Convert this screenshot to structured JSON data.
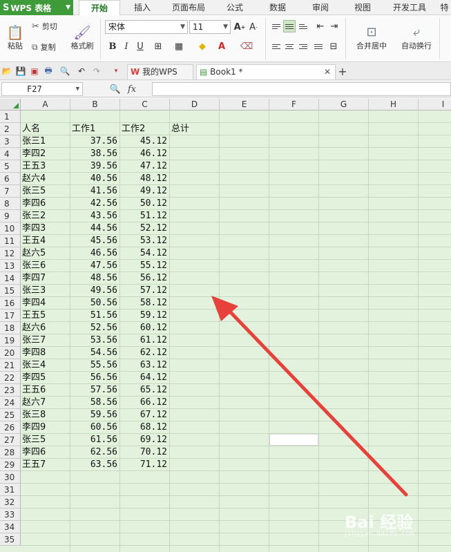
{
  "app": {
    "logo": "S",
    "name": "WPS 表格"
  },
  "menu": {
    "tabs": [
      "开始",
      "插入",
      "页面布局",
      "公式",
      "数据",
      "审阅",
      "视图",
      "开发工具",
      "特"
    ]
  },
  "ribbon": {
    "paste": "粘贴",
    "cut": "剪切",
    "copy": "复制",
    "format_painter": "格式刷",
    "font_name": "宋体",
    "font_size": "11",
    "bold": "B",
    "italic": "I",
    "underline": "U",
    "merge_center": "合并居中",
    "wrap_text": "自动换行"
  },
  "doc_tabs": {
    "home": "我的WPS",
    "book": "Book1 *"
  },
  "formula_bar": {
    "cell_ref": "F27",
    "fx": "fx",
    "value": ""
  },
  "sheet": {
    "columns": [
      "A",
      "B",
      "C",
      "D",
      "E",
      "F",
      "G",
      "H",
      "I"
    ],
    "row_numbers": [
      "1",
      "2",
      "3",
      "4",
      "5",
      "6",
      "7",
      "8",
      "9",
      "10",
      "11",
      "12",
      "13",
      "14",
      "15",
      "16",
      "17",
      "18",
      "19",
      "20",
      "21",
      "22",
      "23",
      "24",
      "25",
      "26",
      "27",
      "28",
      "29",
      "30",
      "31",
      "32",
      "33",
      "34",
      "35"
    ],
    "header": [
      "人名",
      "工作1",
      "工作2",
      "总计"
    ],
    "rows": [
      [
        "张三1",
        "37.56",
        "45.12"
      ],
      [
        "李四2",
        "38.56",
        "46.12"
      ],
      [
        "王五3",
        "39.56",
        "47.12"
      ],
      [
        "赵六4",
        "40.56",
        "48.12"
      ],
      [
        "张三5",
        "41.56",
        "49.12"
      ],
      [
        "李四6",
        "42.56",
        "50.12"
      ],
      [
        "张三2",
        "43.56",
        "51.12"
      ],
      [
        "李四3",
        "44.56",
        "52.12"
      ],
      [
        "王五4",
        "45.56",
        "53.12"
      ],
      [
        "赵六5",
        "46.56",
        "54.12"
      ],
      [
        "张三6",
        "47.56",
        "55.12"
      ],
      [
        "李四7",
        "48.56",
        "56.12"
      ],
      [
        "张三3",
        "49.56",
        "57.12"
      ],
      [
        "李四4",
        "50.56",
        "58.12"
      ],
      [
        "王五5",
        "51.56",
        "59.12"
      ],
      [
        "赵六6",
        "52.56",
        "60.12"
      ],
      [
        "张三7",
        "53.56",
        "61.12"
      ],
      [
        "李四8",
        "54.56",
        "62.12"
      ],
      [
        "张三4",
        "55.56",
        "63.12"
      ],
      [
        "李四5",
        "56.56",
        "64.12"
      ],
      [
        "王五6",
        "57.56",
        "65.12"
      ],
      [
        "赵六7",
        "58.56",
        "66.12"
      ],
      [
        "张三8",
        "59.56",
        "67.12"
      ],
      [
        "李四9",
        "60.56",
        "68.12"
      ],
      [
        "张三5",
        "61.56",
        "69.12"
      ],
      [
        "李四6",
        "62.56",
        "70.12"
      ],
      [
        "王五7",
        "63.56",
        "71.12"
      ]
    ],
    "active_cell": "F27"
  },
  "watermark": {
    "main": "Bai 经验",
    "sub": "jingyan.baidu.com"
  },
  "colors": {
    "app_green": "#3f9b3a",
    "grid_bg": "#e2f2dd",
    "arrow": "#e8403a"
  }
}
